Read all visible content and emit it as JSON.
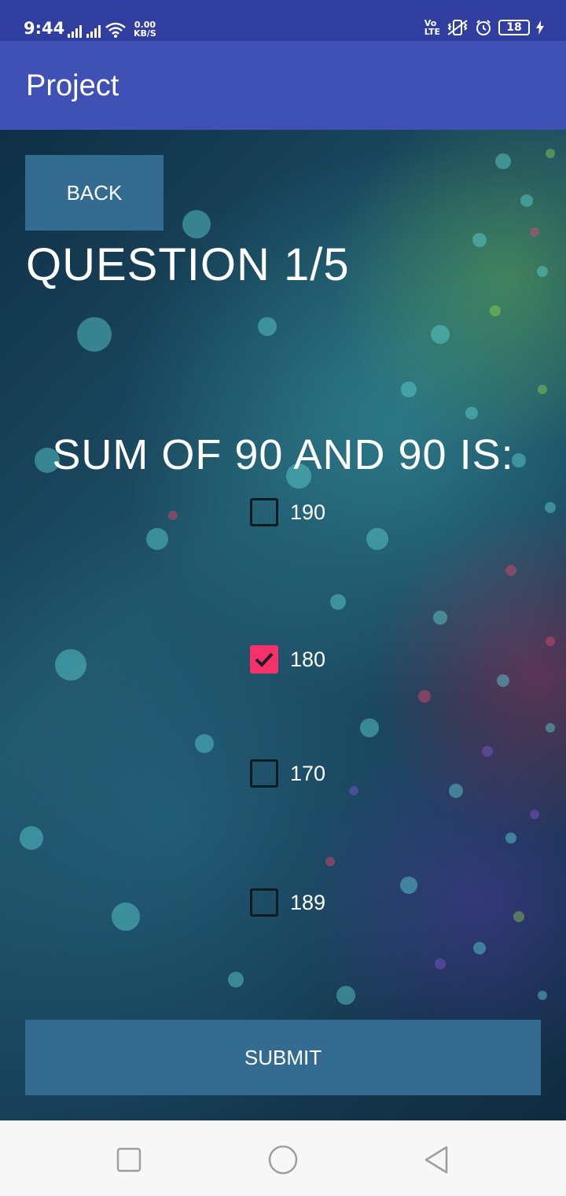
{
  "status_bar": {
    "time": "9:44",
    "net_speed_value": "0.00",
    "net_speed_unit": "KB/S",
    "volte_top": "Vo",
    "volte_bottom": "LTE",
    "battery": "18"
  },
  "app_bar": {
    "title": "Project"
  },
  "quiz": {
    "back_label": "BACK",
    "counter": "QUESTION 1/5",
    "question": "SUM OF 90 AND 90 IS:",
    "options": [
      {
        "label": "190",
        "checked": false
      },
      {
        "label": "180",
        "checked": true
      },
      {
        "label": "170",
        "checked": false
      },
      {
        "label": "189",
        "checked": false
      }
    ],
    "submit_label": "SUBMIT"
  },
  "colors": {
    "status_bar": "#303f9f",
    "app_bar": "#3f51b5",
    "button": "#346c91",
    "checkbox_checked": "#f5316a"
  },
  "icons": {
    "nav_recents": "square-icon",
    "nav_home": "circle-icon",
    "nav_back": "triangle-back-icon"
  }
}
